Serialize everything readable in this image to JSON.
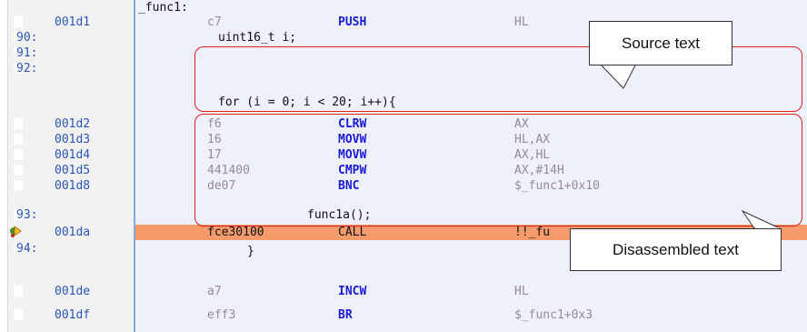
{
  "function_label": "_func1:",
  "rows": [
    {
      "kind": "asm",
      "addr": "001d1",
      "op": "c7",
      "mn": "PUSH",
      "arg": "HL"
    },
    {
      "kind": "src",
      "line": "90:",
      "code": "uint16_t i;"
    },
    {
      "kind": "src",
      "line": "91:",
      "code": ""
    },
    {
      "kind": "src",
      "line": "92:",
      "code": "for (i = 0; i < 20; i++){"
    },
    {
      "kind": "asm",
      "addr": "001d2",
      "op": "f6",
      "mn": "CLRW",
      "arg": "AX"
    },
    {
      "kind": "asm",
      "addr": "001d3",
      "op": "16",
      "mn": "MOVW",
      "arg": "HL,AX"
    },
    {
      "kind": "asm",
      "addr": "001d4",
      "op": "17",
      "mn": "MOVW",
      "arg": "AX,HL"
    },
    {
      "kind": "asm",
      "addr": "001d5",
      "op": "441400",
      "mn": "CMPW",
      "arg": "AX,#14H"
    },
    {
      "kind": "asm",
      "addr": "001d8",
      "op": "de07",
      "mn": "BNC",
      "arg": "$_func1+0x10"
    },
    {
      "kind": "src",
      "line": "93:",
      "code": "func1a();"
    },
    {
      "kind": "asm",
      "addr": "001da",
      "op": "fce30100",
      "mn": "CALL",
      "arg": "!!_fu",
      "current": true
    },
    {
      "kind": "src",
      "line": "94:",
      "code": "}"
    },
    {
      "kind": "asm",
      "addr": "001de",
      "op": "a7",
      "mn": "INCW",
      "arg": "HL"
    },
    {
      "kind": "asm",
      "addr": "001df",
      "op": "eff3",
      "mn": "BR",
      "arg": "$_func1+0x3"
    }
  ],
  "callouts": {
    "source": "Source text",
    "disassembled": "Disassembled text"
  },
  "colors": {
    "highlight": "#f59b6b",
    "address": "#2b56b8",
    "mnemonic": "#1a1ad6",
    "annotation_box": "#e02020"
  },
  "icons": {
    "current_line": "program-counter-arrow-icon"
  }
}
